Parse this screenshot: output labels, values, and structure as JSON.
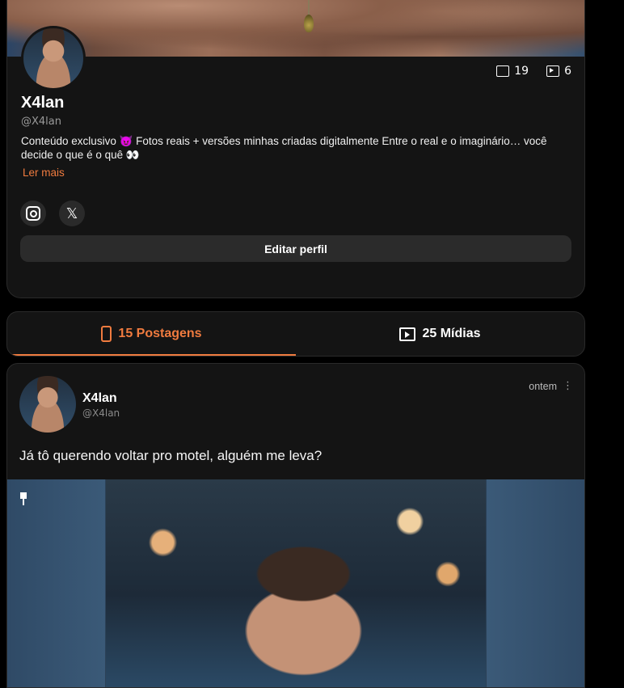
{
  "profile": {
    "name": "X4lan",
    "handle": "@X4lan",
    "bio": "Conteúdo exclusivo 😈 Fotos reais + versões minhas criadas digitalmente Entre o real e o imaginário… você decide o que é o quê 👀",
    "read_more": "Ler mais",
    "photo_count": "19",
    "video_count": "6",
    "edit_button": "Editar perfil",
    "social_x_glyph": "𝕏"
  },
  "tabs": [
    {
      "label": "15 Postagens",
      "active": true
    },
    {
      "label": "25 Mídias",
      "active": false
    }
  ],
  "post": {
    "author_name": "X4lan",
    "author_handle": "@X4lan",
    "time": "ontem",
    "menu_glyph": "⋮",
    "text": "Já tô querendo voltar pro motel, alguém me leva?"
  },
  "colors": {
    "accent": "#f07b3f",
    "background": "#000000",
    "card": "#141414"
  }
}
